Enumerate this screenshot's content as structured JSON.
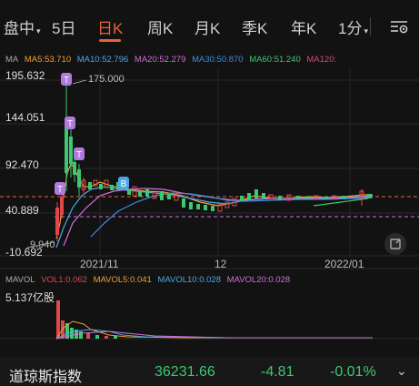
{
  "tabs": [
    {
      "label": "盘中",
      "has_dropdown": true
    },
    {
      "label": "5日"
    },
    {
      "label": "日K",
      "active": true
    },
    {
      "label": "周K"
    },
    {
      "label": "月K"
    },
    {
      "label": "季K"
    },
    {
      "label": "年K"
    },
    {
      "label": "1分",
      "has_dropdown": true
    }
  ],
  "ma_legend": [
    {
      "label": "MA",
      "color": "#aaaaaa"
    },
    {
      "label": "MA5:53.710",
      "color": "#f0a030"
    },
    {
      "label": "MA10:52.796",
      "color": "#4aa8e8"
    },
    {
      "label": "MA20:52.279",
      "color": "#d070d8"
    },
    {
      "label": "MA30:50.870",
      "color": "#3a8ee0"
    },
    {
      "label": "MA60:51.240",
      "color": "#3cc870"
    },
    {
      "label": "MA120:",
      "color": "#e04868"
    }
  ],
  "price_axis": {
    "high": "195.632",
    "p2": "144.051",
    "p3": "92.470",
    "p4": "40.889",
    "low": "-10.692"
  },
  "annotations": {
    "max_marker": "175.000",
    "min_marker": "9.940"
  },
  "dates": [
    "2021/11",
    "12",
    "2022/01"
  ],
  "vol_legend": [
    {
      "label": "MAVOL",
      "color": "#aaaaaa"
    },
    {
      "label": "VOL1:0.062",
      "color": "#e04848"
    },
    {
      "label": "MAVOL5:0.041",
      "color": "#f0a030"
    },
    {
      "label": "MAVOL10:0.028",
      "color": "#4aa8e8"
    },
    {
      "label": "MAVOL20:0.028",
      "color": "#d070d8"
    }
  ],
  "volume_axis_label": "5.137亿股",
  "quote": {
    "name": "道琼斯指数",
    "price": "36231.66",
    "change": "-4.81",
    "change_pct": "-0.01%"
  },
  "colors": {
    "accent": "#e8623a",
    "up": "#e04848",
    "down": "#3cc870",
    "marker": "#b07ae0"
  },
  "icons": {
    "settings": "settings-sliders-icon",
    "reset": "reset-zoom-icon",
    "expand": "chevron-down-icon"
  }
}
